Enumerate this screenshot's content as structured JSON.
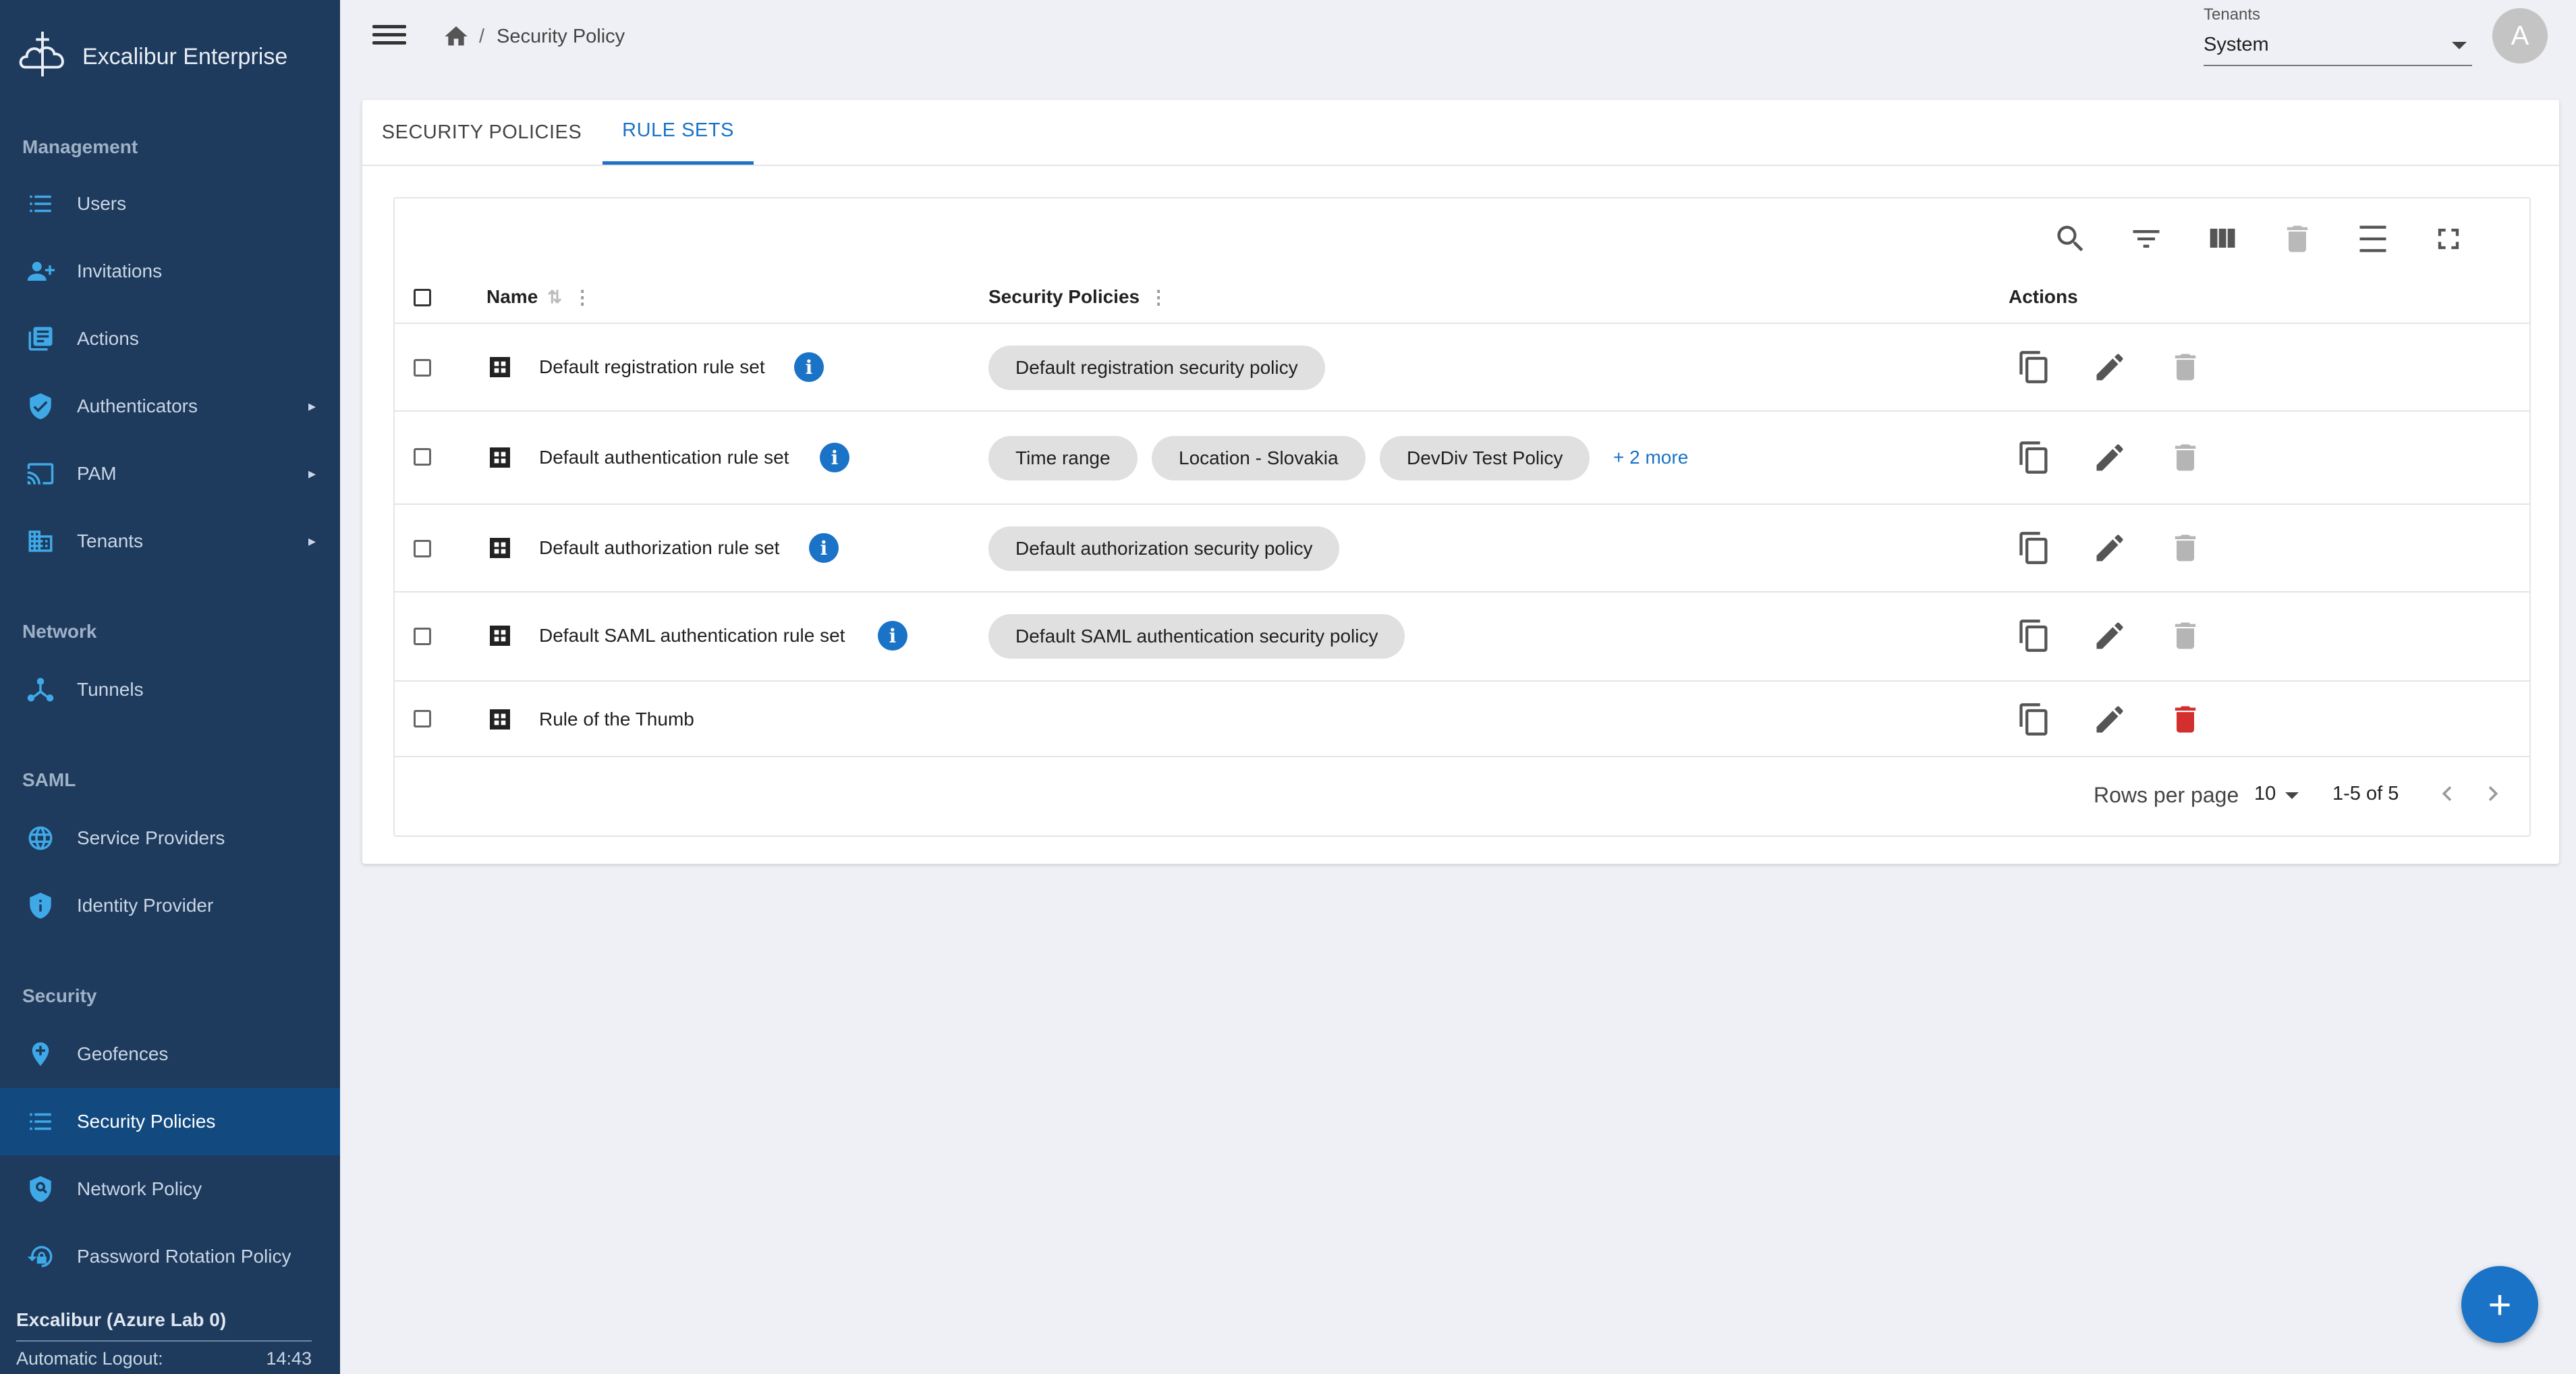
{
  "app": {
    "name": "Excalibur Enterprise"
  },
  "sidebar": {
    "sections": [
      {
        "title": "Management"
      },
      {
        "title": "Network"
      },
      {
        "title": "SAML"
      },
      {
        "title": "Security"
      }
    ],
    "items": [
      {
        "label": "Users",
        "icon": "list-icon"
      },
      {
        "label": "Invitations",
        "icon": "person-add-icon"
      },
      {
        "label": "Actions",
        "icon": "library-icon"
      },
      {
        "label": "Authenticators",
        "icon": "shield-check-icon",
        "expandable": true
      },
      {
        "label": "PAM",
        "icon": "cast-icon",
        "expandable": true
      },
      {
        "label": "Tenants",
        "icon": "building-icon",
        "expandable": true
      },
      {
        "label": "Tunnels",
        "icon": "hub-icon"
      },
      {
        "label": "Service Providers",
        "icon": "globe-icon"
      },
      {
        "label": "Identity Provider",
        "icon": "shield-info-icon"
      },
      {
        "label": "Geofences",
        "icon": "location-plus-icon"
      },
      {
        "label": "Security Policies",
        "icon": "list-icon",
        "active": true
      },
      {
        "label": "Network Policy",
        "icon": "shield-search-icon"
      },
      {
        "label": "Password Rotation Policy",
        "icon": "lock-reset-icon"
      }
    ],
    "footer": {
      "org": "Excalibur (Azure Lab 0)",
      "logout_label": "Automatic Logout:",
      "logout_time": "14:43"
    }
  },
  "header": {
    "breadcrumb_separator": "/",
    "breadcrumb_current": "Security Policy",
    "tenant_label": "Tenants",
    "tenant_value": "System",
    "avatar_initial": "A"
  },
  "tabs": [
    {
      "label": "SECURITY POLICIES",
      "active": false
    },
    {
      "label": "RULE SETS",
      "active": true
    }
  ],
  "table": {
    "columns": {
      "name": "Name",
      "policies": "Security Policies",
      "actions": "Actions"
    },
    "rows": [
      {
        "name": "Default registration rule set",
        "info": "i",
        "policies": [
          "Default registration security policy"
        ],
        "more": "",
        "delete_enabled": false
      },
      {
        "name": "Default authentication rule set",
        "info": "i",
        "policies": [
          "Time range",
          "Location - Slovakia",
          "DevDiv Test Policy"
        ],
        "more": "+ 2 more",
        "delete_enabled": false
      },
      {
        "name": "Default authorization rule set",
        "info": "i",
        "policies": [
          "Default authorization security policy"
        ],
        "more": "",
        "delete_enabled": false
      },
      {
        "name": "Default SAML authentication rule set",
        "info": "i",
        "policies": [
          "Default SAML authentication security policy"
        ],
        "more": "",
        "delete_enabled": false
      },
      {
        "name": "Rule of the Thumb",
        "info": "",
        "policies": [],
        "more": "",
        "delete_enabled": true
      }
    ],
    "pagination": {
      "rows_per_page_label": "Rows per page",
      "rows_per_page": "10",
      "range": "1-5 of 5"
    }
  },
  "fab": {
    "label": "+"
  },
  "colors": {
    "sidebar_bg": "#1e3a5c",
    "sidebar_active": "#124a80",
    "accent": "#1a73c6",
    "danger": "#d32f2f",
    "icon_blue": "#3fa9e8"
  }
}
